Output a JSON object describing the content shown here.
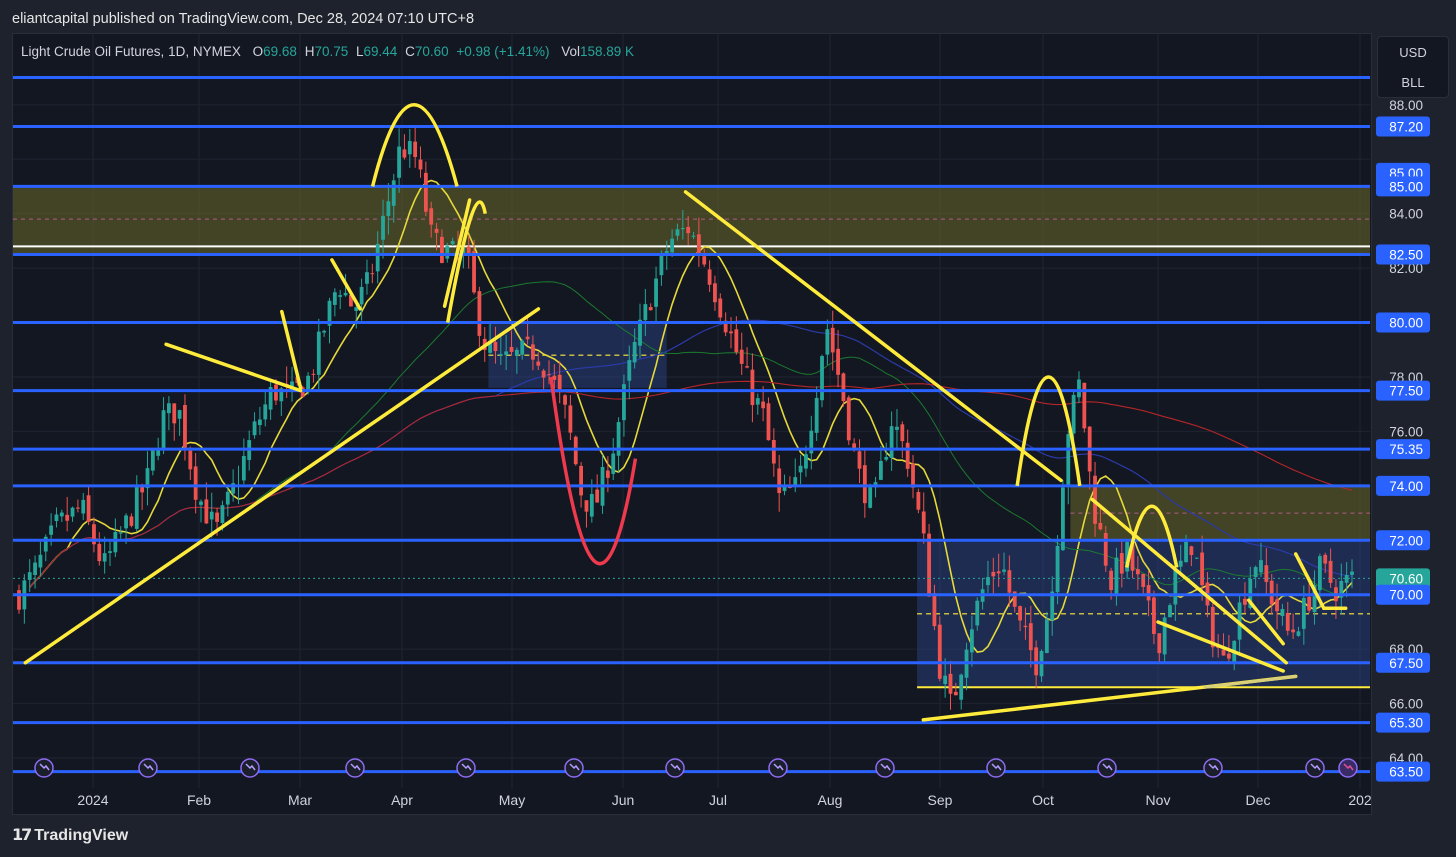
{
  "header": {
    "published_by": "eliantcapital published on TradingView.com, Dec 28, 2024 07:10 UTC+8"
  },
  "legend": {
    "symbol": "Light Crude Oil Futures, 1D, NYMEX",
    "open_label": "O",
    "open": "69.68",
    "high_label": "H",
    "high": "70.75",
    "low_label": "L",
    "low": "69.44",
    "close_label": "C",
    "close": "70.60",
    "change": "+0.98 (+1.41%)",
    "volume_label": "Vol",
    "volume": "158.89 K"
  },
  "units": {
    "currency": "USD",
    "unit": "BLL"
  },
  "footer": {
    "brand": "TradingView"
  },
  "colors": {
    "background": "#131722",
    "up": "#26a69a",
    "down": "#ef5350",
    "level_line": "#2962ff",
    "drawing": "#ffeb3b",
    "label_bg": "#2962ff"
  },
  "chart_data": {
    "type": "candlestick",
    "symbol": "Light Crude Oil Futures",
    "timeframe": "1D",
    "exchange": "NYMEX",
    "x_tick_labels": [
      "2024",
      "Feb",
      "Mar",
      "Apr",
      "May",
      "Jun",
      "Jul",
      "Aug",
      "Sep",
      "Oct",
      "Nov",
      "Dec",
      "202"
    ],
    "y_tick_labels": [
      88,
      86,
      84,
      82,
      80,
      78,
      76,
      74,
      72,
      68,
      66,
      64
    ],
    "ylim": [
      62.9,
      90.6
    ],
    "horizontal_levels": [
      89.0,
      87.2,
      85.0,
      82.5,
      80.0,
      77.5,
      75.35,
      74.0,
      72.0,
      70.0,
      67.5,
      65.3,
      63.5
    ],
    "level_labels": [
      "87.20",
      "85.00",
      "85.00",
      "82.50",
      "80.00",
      "77.50",
      "75.35",
      "74.00",
      "72.00",
      "70.60",
      "70.00",
      "67.50",
      "65.30",
      "63.50"
    ],
    "y_labels": [
      "88.00",
      "84.00",
      "82.00",
      "78.00",
      "76.00",
      "68.00",
      "66.00",
      "64.00"
    ],
    "last_price": 70.6,
    "price_path": [
      [
        0,
        70.0
      ],
      [
        0.5,
        70.8
      ],
      [
        1.2,
        72.5
      ],
      [
        2.0,
        73.2
      ],
      [
        2.7,
        71.0
      ],
      [
        3.3,
        72.3
      ],
      [
        4.1,
        74.2
      ],
      [
        4.6,
        76.5
      ],
      [
        5.1,
        76.8
      ],
      [
        5.7,
        73.7
      ],
      [
        6.3,
        72.3
      ],
      [
        6.9,
        74.0
      ],
      [
        7.5,
        76.0
      ],
      [
        8.1,
        77.5
      ],
      [
        8.7,
        77.3
      ],
      [
        9.3,
        78.0
      ],
      [
        9.8,
        80.0
      ],
      [
        10.2,
        81.5
      ],
      [
        10.7,
        80.5
      ],
      [
        11.2,
        81.5
      ],
      [
        11.7,
        84.0
      ],
      [
        12.2,
        86.5
      ],
      [
        12.7,
        86.0
      ],
      [
        13.2,
        83.0
      ],
      [
        13.8,
        82.5
      ],
      [
        14.3,
        82.5
      ],
      [
        14.6,
        80.5
      ],
      [
        14.9,
        79.2
      ],
      [
        15.4,
        78.5
      ],
      [
        16.0,
        78.8
      ],
      [
        16.5,
        79.0
      ],
      [
        17.0,
        78.0
      ],
      [
        17.5,
        76.5
      ],
      [
        18.0,
        73.6
      ],
      [
        18.4,
        73.2
      ],
      [
        19.0,
        75.5
      ],
      [
        19.6,
        78.8
      ],
      [
        20.2,
        81.0
      ],
      [
        20.8,
        83.0
      ],
      [
        21.4,
        83.5
      ],
      [
        22.0,
        82.0
      ],
      [
        22.6,
        80.0
      ],
      [
        23.2,
        78.0
      ],
      [
        23.8,
        76.5
      ],
      [
        24.3,
        73.5
      ],
      [
        24.9,
        74.0
      ],
      [
        25.4,
        77.0
      ],
      [
        25.8,
        80.0
      ],
      [
        26.3,
        77.5
      ],
      [
        26.8,
        74.5
      ],
      [
        27.3,
        73.2
      ],
      [
        27.9,
        76.5
      ],
      [
        28.4,
        75.0
      ],
      [
        28.9,
        72.0
      ],
      [
        29.4,
        67.5
      ],
      [
        29.8,
        65.8
      ],
      [
        30.3,
        68.5
      ],
      [
        30.9,
        70.5
      ],
      [
        31.4,
        71.2
      ],
      [
        31.9,
        69.0
      ],
      [
        32.5,
        67.5
      ],
      [
        33.0,
        70.0
      ],
      [
        33.5,
        76.0
      ],
      [
        33.9,
        77.8
      ],
      [
        34.3,
        73.5
      ],
      [
        34.9,
        70.5
      ],
      [
        35.4,
        71.5
      ],
      [
        35.9,
        70.0
      ],
      [
        36.4,
        68.2
      ],
      [
        36.9,
        70.5
      ],
      [
        37.5,
        72.0
      ],
      [
        38.0,
        69.0
      ],
      [
        38.5,
        67.5
      ],
      [
        39.0,
        69.5
      ],
      [
        39.5,
        71.3
      ],
      [
        40.0,
        70.0
      ],
      [
        40.6,
        68.5
      ],
      [
        41.1,
        69.5
      ],
      [
        41.6,
        71.0
      ],
      [
        42.1,
        70.2
      ],
      [
        42.6,
        70.6
      ]
    ],
    "annotations": [
      "yellow trendlines and channel",
      "yellow arcs over Apr and Oct highs",
      "red arc under Jun low",
      "yellow supply/demand zones 82.5-85 and 72-74",
      "blue range box Sep-Dec 66.5-72"
    ]
  }
}
